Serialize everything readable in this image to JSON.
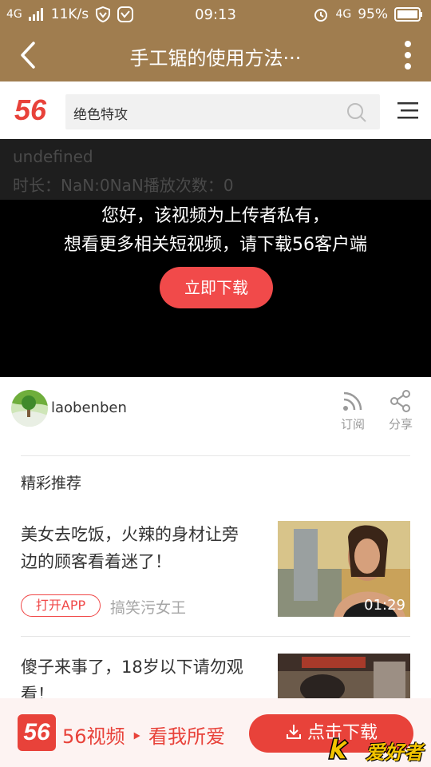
{
  "status_bar": {
    "network": "4G",
    "speed": "11K/s",
    "time": "09:13",
    "network_right": "4G",
    "battery": "95%"
  },
  "app_bar": {
    "title": "手工锯的使用方法···"
  },
  "site_header": {
    "logo_text": "56",
    "search_value": "绝色特攻"
  },
  "player": {
    "overlay_line1": "undefined",
    "overlay_line2": "时长：NaN:0NaN播放次数：0",
    "message_line1": "您好，该视频为上传者私有，",
    "message_line2": "想看更多相关短视频，请下载56客户端",
    "button_label": "立即下载"
  },
  "uploader": {
    "name": "laobenben",
    "subscribe_label": "订阅",
    "share_label": "分享"
  },
  "recommendations": {
    "section_title": "精彩推荐",
    "items": [
      {
        "title_line1": "美女去吃饭，火辣的身材让旁",
        "title_line2": "边的顾客看着迷了！",
        "tag": "打开APP",
        "author": "搞笑污女王",
        "duration": "01:29"
      },
      {
        "title_line1": "傻子来事了，18岁以下请勿观",
        "title_line2": "看！"
      }
    ]
  },
  "bottom_bar": {
    "logo_text": "56",
    "slogan": "56视频 ‣ 看我所爱",
    "download_label": "点击下载"
  },
  "watermark": {
    "text": "爱好者"
  },
  "colors": {
    "bar_brown": "#a07d4f",
    "accent_red": "#f14a4a",
    "brand_red": "#e8423a"
  }
}
